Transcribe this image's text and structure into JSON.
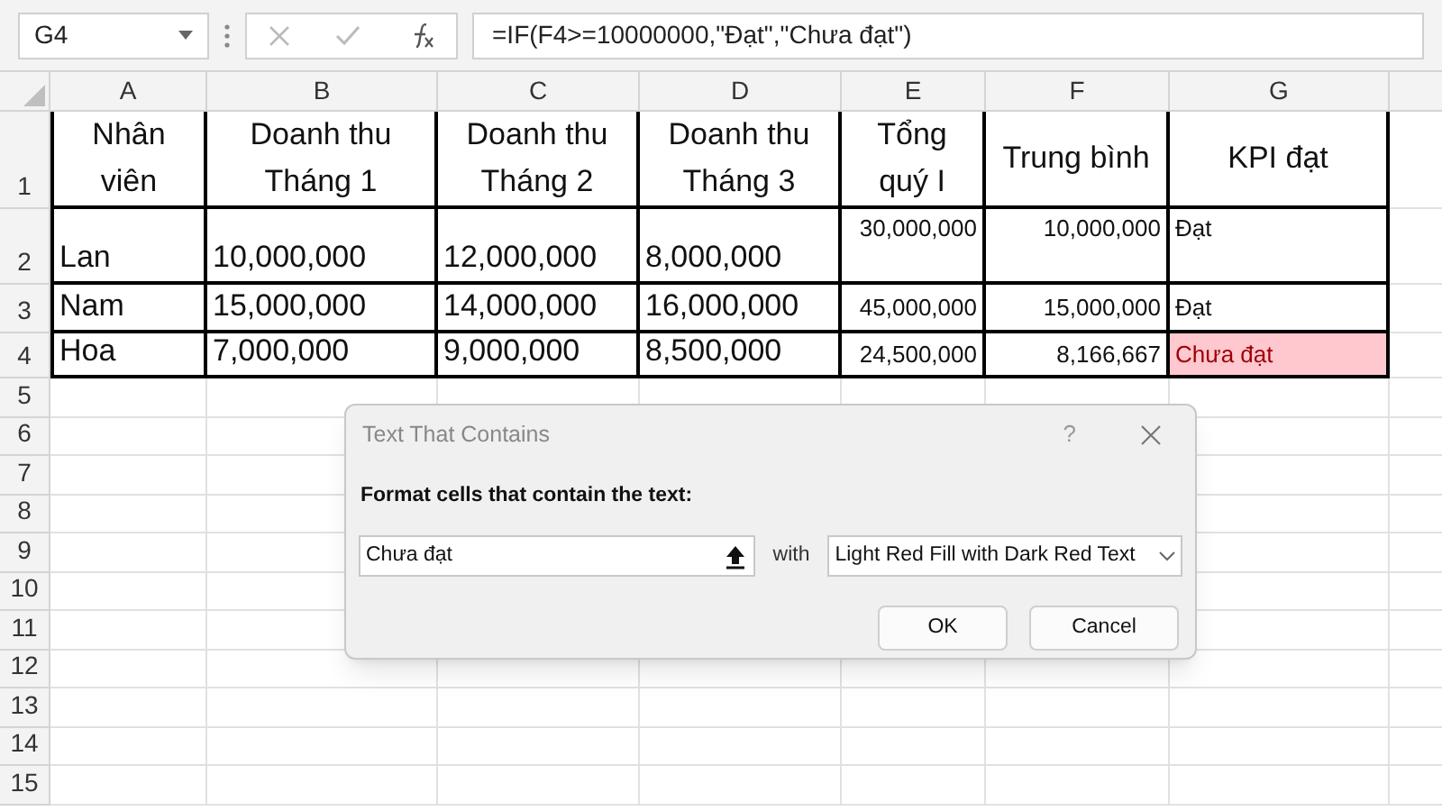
{
  "formula_bar": {
    "name_box": "G4",
    "formula": "=IF(F4>=10000000,\"Đạt\",\"Chưa đạt\")"
  },
  "columns": [
    "A",
    "B",
    "C",
    "D",
    "E",
    "F",
    "G",
    ""
  ],
  "header_row": {
    "number": "1",
    "labels": [
      "Nhân viên",
      "Doanh thu Tháng 1",
      "Doanh thu Tháng 2",
      "Doanh thu Tháng 3",
      "Tổng quý I",
      "Trung bình",
      "KPI đạt"
    ]
  },
  "rows": [
    {
      "number": "2",
      "values": [
        "Lan",
        "10,000,000",
        "12,000,000",
        "8,000,000",
        "30,000,000",
        "10,000,000"
      ],
      "kpi": {
        "text": "Đạt",
        "highlighted": false
      }
    },
    {
      "number": "3",
      "values": [
        "Nam",
        "15,000,000",
        "14,000,000",
        "16,000,000",
        "45,000,000",
        "15,000,000"
      ],
      "kpi": {
        "text": "Đạt",
        "highlighted": false
      }
    },
    {
      "number": "4",
      "values": [
        "Hoa",
        "7,000,000",
        "9,000,000",
        "8,500,000",
        "24,500,000",
        "8,166,667"
      ],
      "kpi": {
        "text": "Chưa đạt",
        "highlighted": true
      }
    }
  ],
  "empty_rows": [
    "5",
    "6",
    "7",
    "8",
    "9",
    "10",
    "11",
    "12",
    "13",
    "14",
    "15"
  ],
  "dialog": {
    "title": "Text That Contains",
    "help": "?",
    "label": "Format cells that contain the text:",
    "text_value": "Chưa đạt",
    "with_label": "with",
    "format": "Light Red Fill with Dark Red Text",
    "buttons": [
      "OK",
      "Cancel"
    ]
  }
}
